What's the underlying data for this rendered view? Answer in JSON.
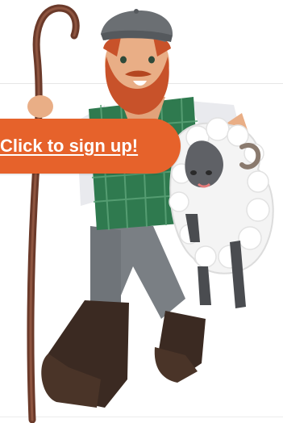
{
  "cta": {
    "label": "Click to sign up!",
    "color": "#e6622b",
    "text_color": "#ffffff"
  },
  "illustration": {
    "subject": "shepherd-with-sheep",
    "icons": [
      "shepherd-icon",
      "crook-icon",
      "sheep-icon",
      "flat-cap-icon"
    ]
  },
  "colors": {
    "background": "#ffffff",
    "vest": "#2f7a4f",
    "beard": "#c8522a",
    "cap": "#6b6f73",
    "trousers": "#7a7f84",
    "boots": "#3b2a22",
    "crook": "#6b3a2a",
    "wool": "#f4f4f4"
  }
}
